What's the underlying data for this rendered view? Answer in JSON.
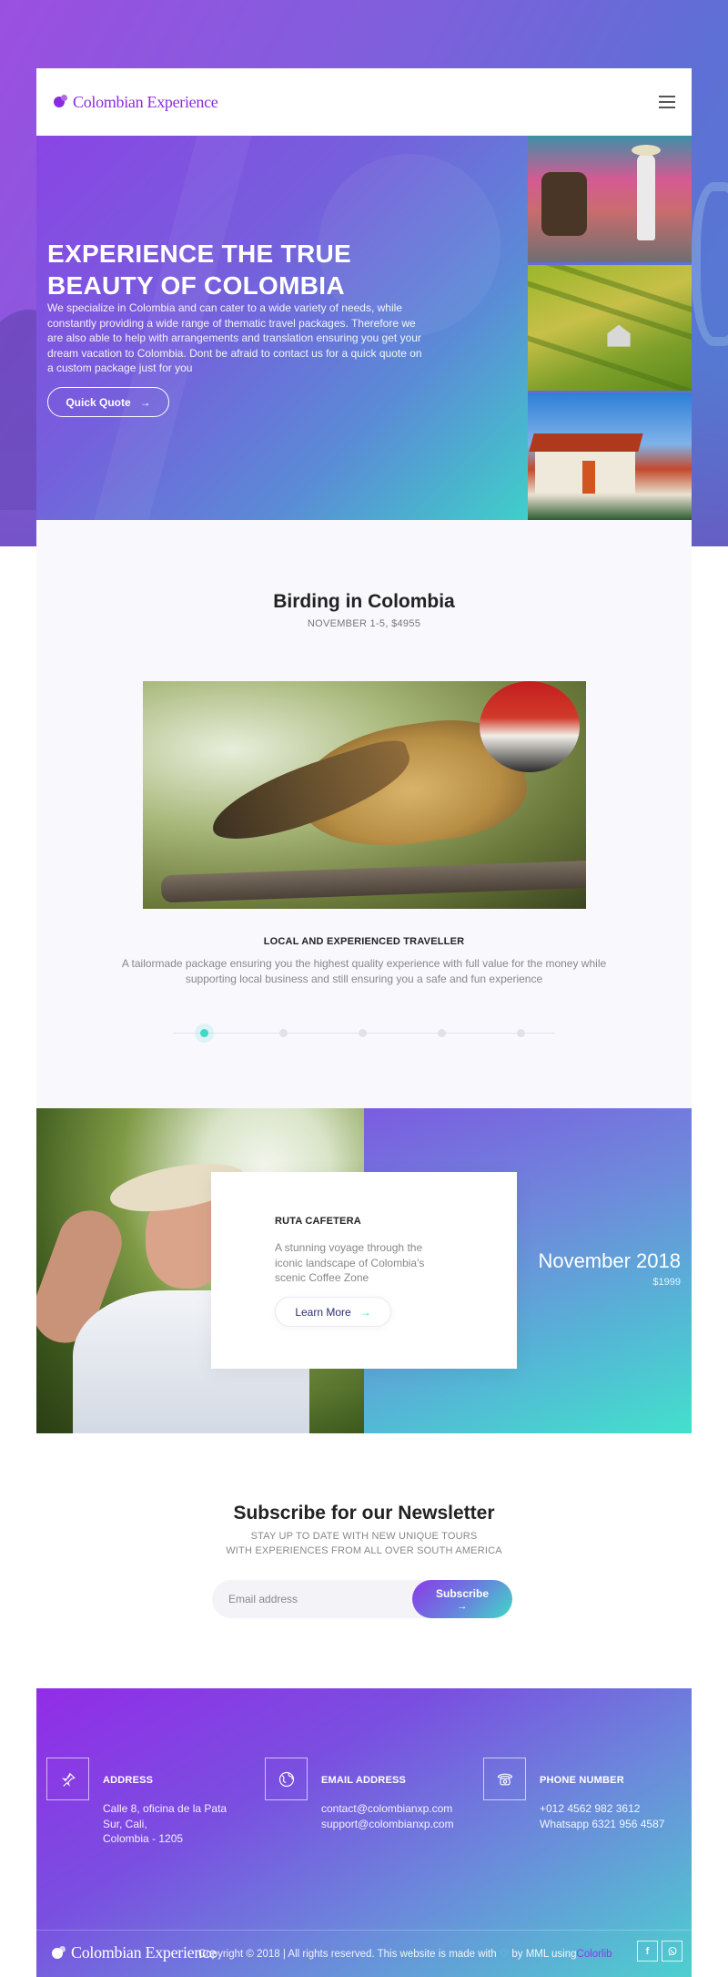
{
  "brand": {
    "name": "Colombian Experience",
    "accent": "#8a2be2",
    "teal": "#40d9c6"
  },
  "header": {
    "menu_icon": "hamburger-icon"
  },
  "hero": {
    "title": "EXPERIENCE THE TRUE BEAUTY OF COLOMBIA",
    "text": "We specialize in Colombia and can cater to a wide variety of needs, while constantly providing a wide range of thematic travel packages. Therefore we are also able to help with arrangements and translation ensuring you get your dream vacation to Colombia. Dont be afraid to contact us for a quick quote on a custom package just for you",
    "button": "Quick Quote",
    "button_arrow": "→"
  },
  "birding": {
    "title": "Birding in Colombia",
    "subtitle": "NOVEMBER 1-5, $4955",
    "heading": "LOCAL AND EXPERIENCED TRAVELLER",
    "text": "A tailormade package ensuring you the highest quality experience with full value for the money while supporting local business and still ensuring you a safe and fun experience",
    "slides_total": 5,
    "active_slide": 1
  },
  "ruta": {
    "title": "RUTA CAFETERA",
    "text": "A stunning voyage through the iconic landscape of Colombia's scenic Coffee Zone",
    "button": "Learn More",
    "button_arrow": "→",
    "date": "November 2018",
    "price": "$1999"
  },
  "newsletter": {
    "title": "Subscribe for our Newsletter",
    "subtitle_line1": "STAY UP TO DATE WITH NEW UNIQUE TOURS",
    "subtitle_line2": "WITH EXPERIENCES FROM ALL OVER SOUTH AMERICA",
    "placeholder": "Email address",
    "button": "Subscribe",
    "button_arrow": "→"
  },
  "footer": {
    "contacts": [
      {
        "label": "ADDRESS",
        "icon": "pin-icon",
        "lines": [
          "Calle 8, oficina de la Pata",
          "Sur, Cali,",
          "Colombia - 1205"
        ]
      },
      {
        "label": "EMAIL ADDRESS",
        "icon": "globe-icon",
        "lines": [
          "contact@colombianxp.com",
          "support@colombianxp.com"
        ]
      },
      {
        "label": "PHONE NUMBER",
        "icon": "phone-icon",
        "lines": [
          "+012 4562 982 3612",
          "Whatsapp 6321 956 4587"
        ]
      }
    ],
    "copyright_pre": "Copyright © 2018 | All rights reserved. This website is made with",
    "copyright_mid": "by MML using",
    "copyright_link": "Colorlib",
    "social": [
      "f",
      "w"
    ]
  }
}
